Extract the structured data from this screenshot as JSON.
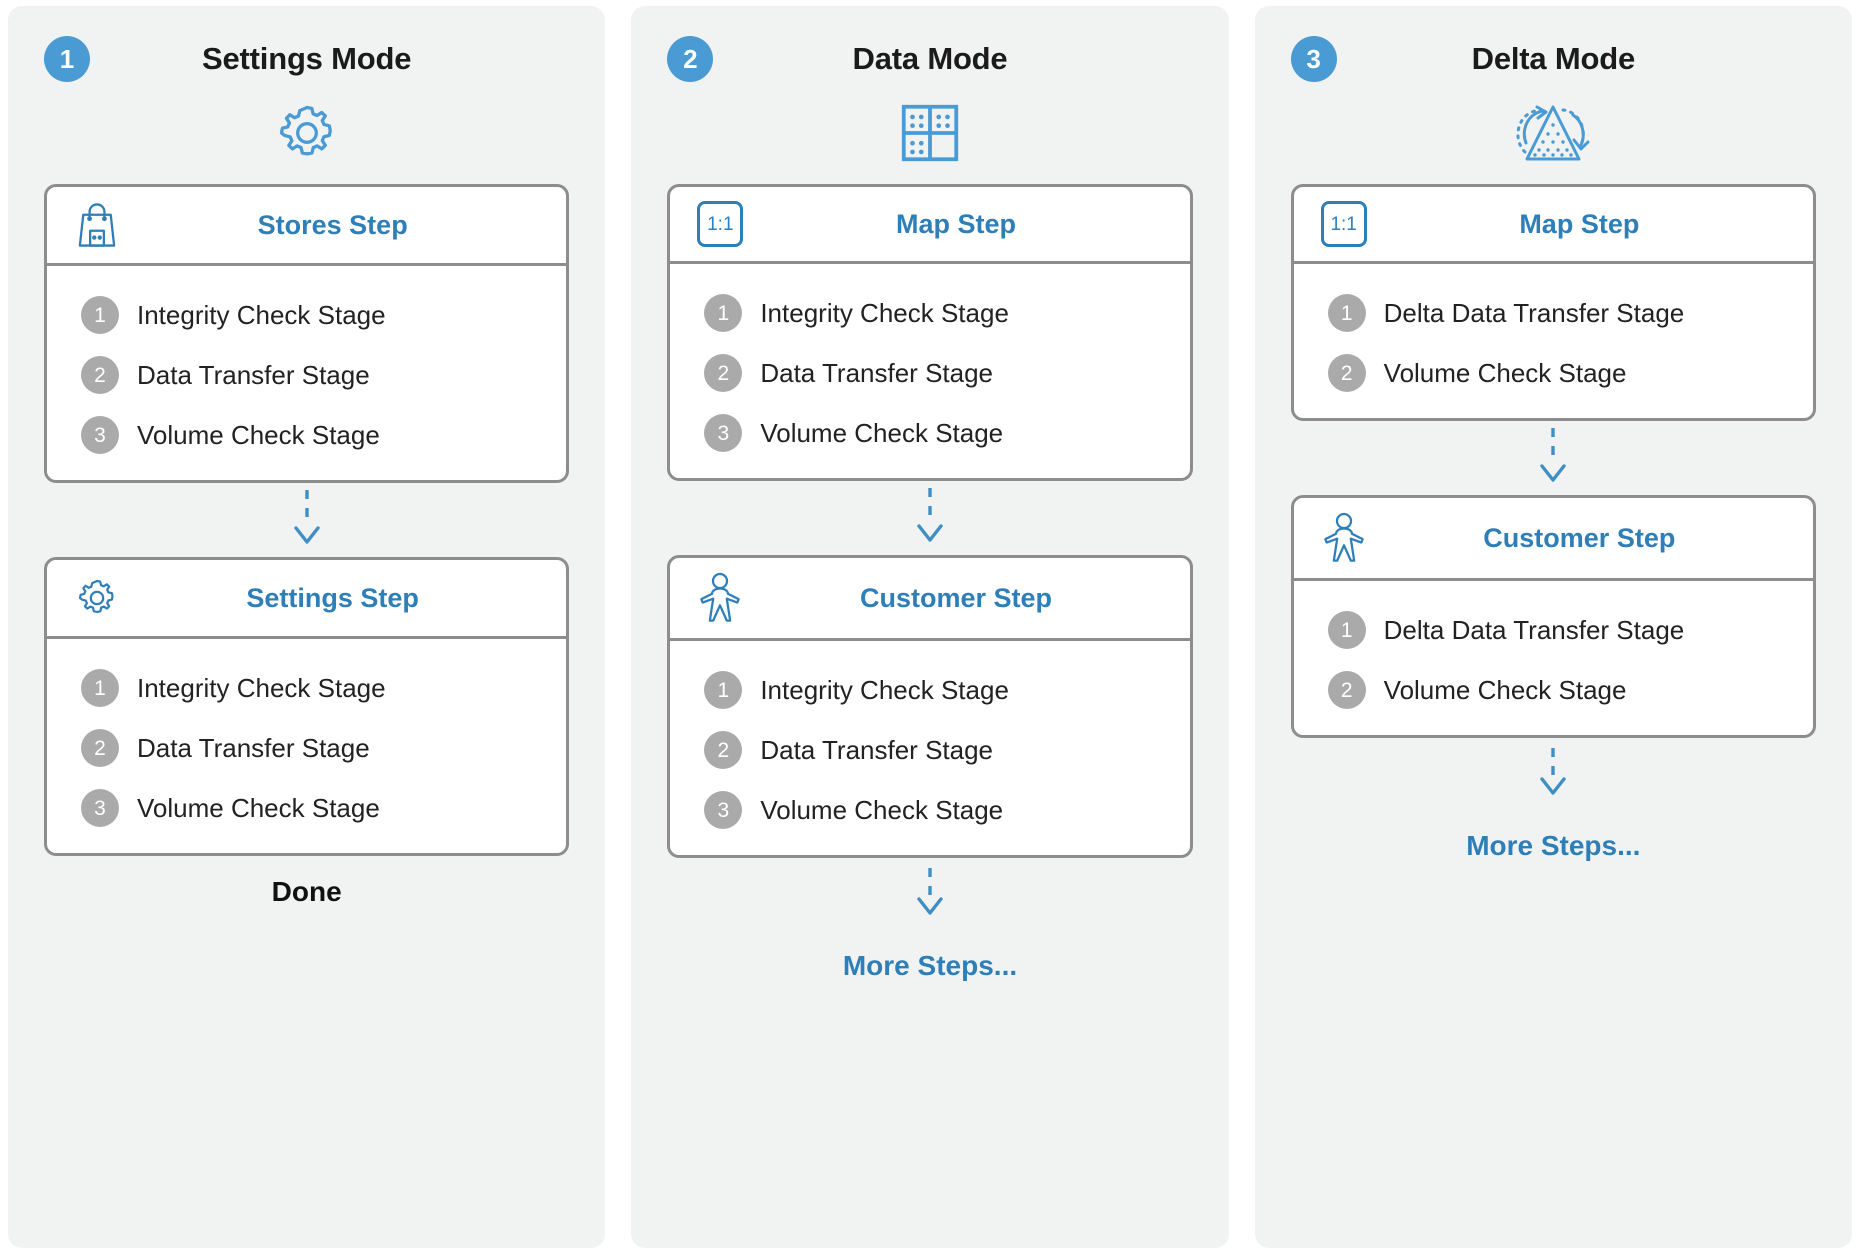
{
  "colors": {
    "accent_blue": "#4a9bd4",
    "title_blue": "#2e7fb8",
    "panel_bg": "#f1f3f2",
    "card_border": "#8d8d8d",
    "stage_badge_gray": "#aaaaaa",
    "text_dark": "#222222"
  },
  "columns": [
    {
      "number": "1",
      "title": "Settings Mode",
      "mode_icon": "gear-icon",
      "cards": [
        {
          "icon": "shopping-bag-icon",
          "title": "Stores Step",
          "stages": [
            {
              "num": "1",
              "label": "Integrity Check Stage"
            },
            {
              "num": "2",
              "label": "Data Transfer Stage"
            },
            {
              "num": "3",
              "label": "Volume Check Stage"
            }
          ]
        },
        {
          "icon": "gear-icon",
          "title": "Settings Step",
          "stages": [
            {
              "num": "1",
              "label": "Integrity Check Stage"
            },
            {
              "num": "2",
              "label": "Data Transfer Stage"
            },
            {
              "num": "3",
              "label": "Volume Check Stage"
            }
          ]
        }
      ],
      "footer": "Done",
      "footer_kind": "done"
    },
    {
      "number": "2",
      "title": "Data Mode",
      "mode_icon": "data-grid-icon",
      "cards": [
        {
          "icon": "ratio-1-1-icon",
          "icon_text": "1:1",
          "title": "Map Step",
          "stages": [
            {
              "num": "1",
              "label": "Integrity Check Stage"
            },
            {
              "num": "2",
              "label": "Data Transfer Stage"
            },
            {
              "num": "3",
              "label": "Volume Check Stage"
            }
          ]
        },
        {
          "icon": "person-icon",
          "title": "Customer Step",
          "stages": [
            {
              "num": "1",
              "label": "Integrity Check Stage"
            },
            {
              "num": "2",
              "label": "Data Transfer Stage"
            },
            {
              "num": "3",
              "label": "Volume Check Stage"
            }
          ]
        }
      ],
      "footer": "More Steps...",
      "footer_kind": "more"
    },
    {
      "number": "3",
      "title": "Delta Mode",
      "mode_icon": "delta-triangle-refresh-icon",
      "cards": [
        {
          "icon": "ratio-1-1-icon",
          "icon_text": "1:1",
          "title": "Map Step",
          "stages": [
            {
              "num": "1",
              "label": "Delta Data Transfer Stage"
            },
            {
              "num": "2",
              "label": "Volume Check Stage"
            }
          ]
        },
        {
          "icon": "person-icon",
          "title": "Customer Step",
          "stages": [
            {
              "num": "1",
              "label": "Delta Data Transfer Stage"
            },
            {
              "num": "2",
              "label": "Volume Check Stage"
            }
          ]
        }
      ],
      "footer": "More Steps...",
      "footer_kind": "more"
    }
  ]
}
